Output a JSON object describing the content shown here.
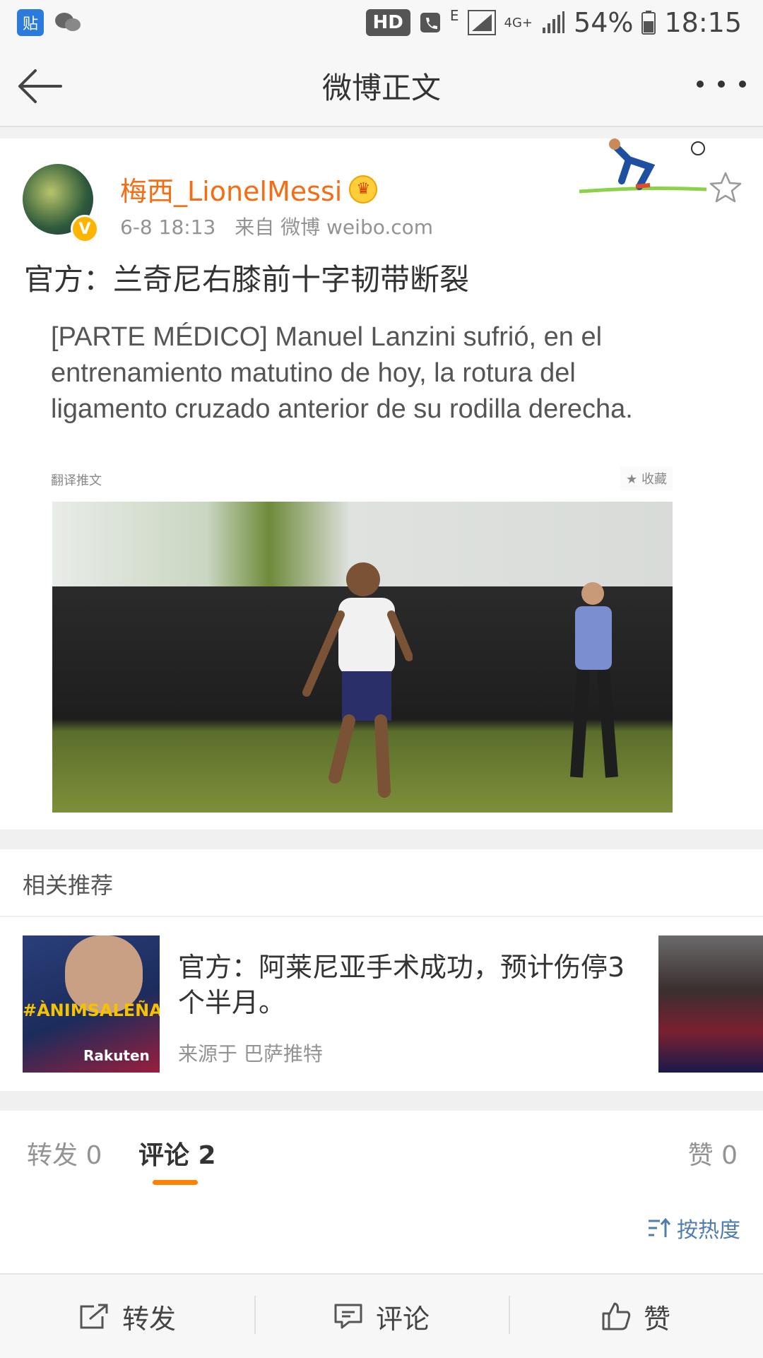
{
  "status_bar": {
    "app_badge": "贴",
    "hd": "HD",
    "network": "4G+",
    "signal_e": "E",
    "battery": "54%",
    "time": "18:15"
  },
  "nav": {
    "title": "微博正文"
  },
  "post": {
    "username": "梅西_LionelMessi",
    "verified_mark": "V",
    "date": "6-8 18:13",
    "source": "来自 微博 weibo.com",
    "title": "官方：兰奇尼右膝前十字韧带断裂",
    "tweet_text": "[PARTE MÉDICO] Manuel Lanzini sufrió, en el entrenamiento matutino de hoy, la rotura del ligamento cruzado anterior de su rodilla derecha.",
    "tweet_translate": "翻译推文",
    "tweet_fav": "★ 收藏"
  },
  "related": {
    "header": "相关推荐",
    "title": "官方：阿莱尼亚手术成功，预计伤停3个半月。",
    "source": "来源于 巴萨推特",
    "thumb_text": "#ÀNIMSALEÑA",
    "thumb_brand": "Rakuten"
  },
  "tabs": {
    "repost": "转发 0",
    "comment": "评论 2",
    "like": "赞 0"
  },
  "sort": {
    "label": "按热度"
  },
  "bottom_bar": {
    "repost": "转发",
    "comment": "评论",
    "like": "赞"
  },
  "colors": {
    "username": "#f86b12",
    "accent_underline": "#ff8200",
    "link_blue": "#507daf"
  }
}
